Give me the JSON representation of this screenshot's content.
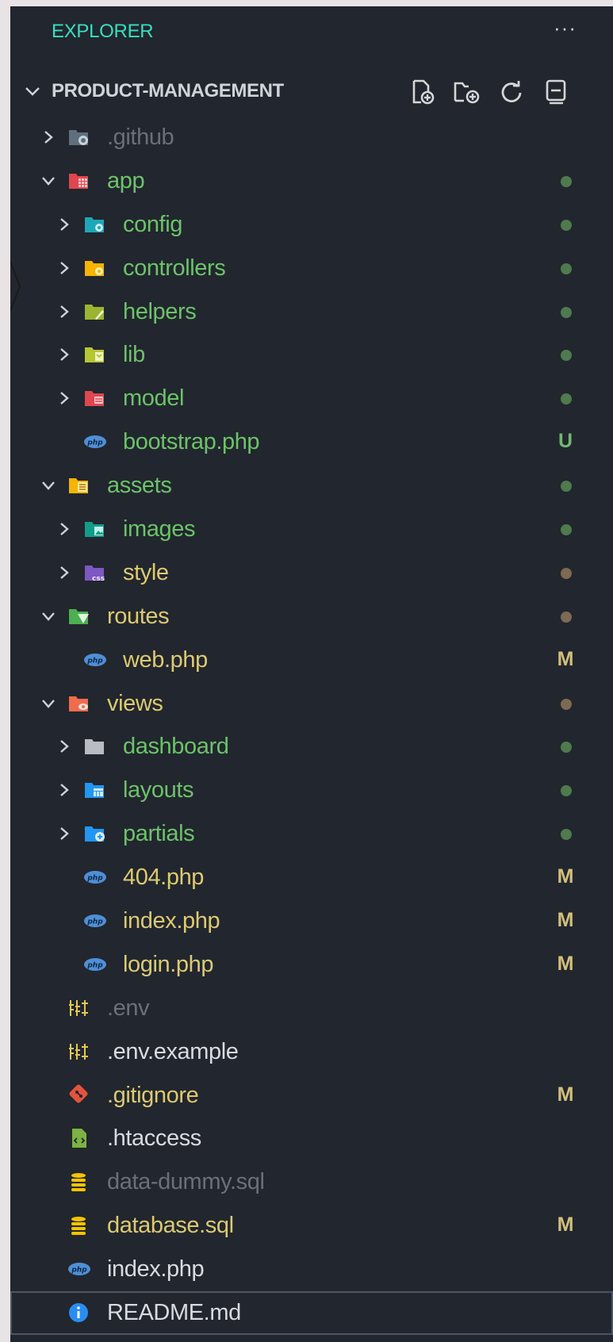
{
  "explorer": {
    "title": "EXPLORER",
    "more": "···"
  },
  "project": {
    "name": "PRODUCT-MANAGEMENT"
  },
  "colors": {
    "green": "#6cc36a",
    "yellow": "#dcca72",
    "dim": "#6b7078",
    "white": "#d8dbe0",
    "dot_green": "#4f7a4e",
    "dot_brown": "#7d6a52",
    "badge_green": "#72b872",
    "badge_yellow": "#d2c07a"
  },
  "tree": [
    {
      "label": ".github",
      "depth": 1,
      "chev": "right",
      "icon": "folder-github-icon",
      "color": "dim",
      "badge": "",
      "dot": ""
    },
    {
      "label": "app",
      "depth": 1,
      "chev": "down",
      "icon": "folder-app-icon",
      "color": "green",
      "badge": "",
      "dot": "green"
    },
    {
      "label": "config",
      "depth": 2,
      "chev": "right",
      "icon": "folder-config-icon",
      "color": "green",
      "badge": "",
      "dot": "green"
    },
    {
      "label": "controllers",
      "depth": 2,
      "chev": "right",
      "icon": "folder-controllers-icon",
      "color": "green",
      "badge": "",
      "dot": "green"
    },
    {
      "label": "helpers",
      "depth": 2,
      "chev": "right",
      "icon": "folder-helpers-icon",
      "color": "green",
      "badge": "",
      "dot": "green"
    },
    {
      "label": "lib",
      "depth": 2,
      "chev": "right",
      "icon": "folder-lib-icon",
      "color": "green",
      "badge": "",
      "dot": "green"
    },
    {
      "label": "model",
      "depth": 2,
      "chev": "right",
      "icon": "folder-model-icon",
      "color": "green",
      "badge": "",
      "dot": "green"
    },
    {
      "label": "bootstrap.php",
      "depth": 2,
      "chev": "",
      "icon": "php-file-icon",
      "color": "green",
      "badge": "U",
      "dot": ""
    },
    {
      "label": "assets",
      "depth": 1,
      "chev": "down",
      "icon": "folder-assets-icon",
      "color": "green",
      "badge": "",
      "dot": "green"
    },
    {
      "label": "images",
      "depth": 2,
      "chev": "right",
      "icon": "folder-images-icon",
      "color": "green",
      "badge": "",
      "dot": "green"
    },
    {
      "label": "style",
      "depth": 2,
      "chev": "right",
      "icon": "folder-css-icon",
      "color": "yellow",
      "badge": "",
      "dot": "brown"
    },
    {
      "label": "routes",
      "depth": 1,
      "chev": "down",
      "icon": "folder-routes-icon",
      "color": "yellow",
      "badge": "",
      "dot": "brown"
    },
    {
      "label": "web.php",
      "depth": 2,
      "chev": "",
      "icon": "php-file-icon",
      "color": "yellow",
      "badge": "M",
      "dot": ""
    },
    {
      "label": "views",
      "depth": 1,
      "chev": "down",
      "icon": "folder-views-icon",
      "color": "yellow",
      "badge": "",
      "dot": "brown"
    },
    {
      "label": "dashboard",
      "depth": 2,
      "chev": "right",
      "icon": "folder-icon",
      "color": "green",
      "badge": "",
      "dot": "green"
    },
    {
      "label": "layouts",
      "depth": 2,
      "chev": "right",
      "icon": "folder-layouts-icon",
      "color": "green",
      "badge": "",
      "dot": "green"
    },
    {
      "label": "partials",
      "depth": 2,
      "chev": "right",
      "icon": "folder-partials-icon",
      "color": "green",
      "badge": "",
      "dot": "green"
    },
    {
      "label": "404.php",
      "depth": 2,
      "chev": "",
      "icon": "php-file-icon",
      "color": "yellow",
      "badge": "M",
      "dot": ""
    },
    {
      "label": "index.php",
      "depth": 2,
      "chev": "",
      "icon": "php-file-icon",
      "color": "yellow",
      "badge": "M",
      "dot": ""
    },
    {
      "label": "login.php",
      "depth": 2,
      "chev": "",
      "icon": "php-file-icon",
      "color": "yellow",
      "badge": "M",
      "dot": ""
    },
    {
      "label": ".env",
      "depth": 1,
      "chev": "",
      "icon": "env-file-icon",
      "color": "dim",
      "badge": "",
      "dot": ""
    },
    {
      "label": ".env.example",
      "depth": 1,
      "chev": "",
      "icon": "env-file-icon",
      "color": "white",
      "badge": "",
      "dot": ""
    },
    {
      "label": ".gitignore",
      "depth": 1,
      "chev": "",
      "icon": "git-file-icon",
      "color": "yellow",
      "badge": "M",
      "dot": ""
    },
    {
      "label": ".htaccess",
      "depth": 1,
      "chev": "",
      "icon": "htaccess-file-icon",
      "color": "white",
      "badge": "",
      "dot": ""
    },
    {
      "label": "data-dummy.sql",
      "depth": 1,
      "chev": "",
      "icon": "database-file-icon",
      "color": "dim",
      "badge": "",
      "dot": ""
    },
    {
      "label": "database.sql",
      "depth": 1,
      "chev": "",
      "icon": "database-file-icon",
      "color": "yellow",
      "badge": "M",
      "dot": ""
    },
    {
      "label": "index.php",
      "depth": 1,
      "chev": "",
      "icon": "php-file-icon",
      "color": "white",
      "badge": "",
      "dot": ""
    },
    {
      "label": "README.md",
      "depth": 1,
      "chev": "",
      "icon": "info-file-icon",
      "color": "white",
      "badge": "",
      "dot": "",
      "selected": true
    }
  ]
}
